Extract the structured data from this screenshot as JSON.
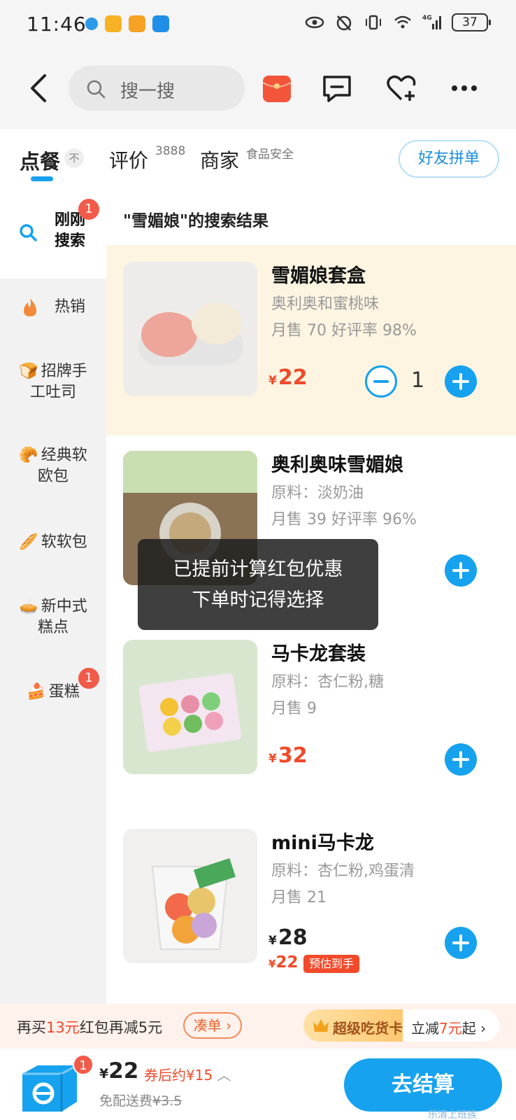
{
  "status_bar": {
    "time": "11:46",
    "battery": "37",
    "network": "4G"
  },
  "search": {
    "placeholder": "搜一搜"
  },
  "tabs": [
    {
      "label": "点餐",
      "sup": ""
    },
    {
      "label": "评价",
      "sup": "3888"
    },
    {
      "label": "商家",
      "sup": "食品安全"
    }
  ],
  "collapse_glyph": "不",
  "friend_order": "好友拼单",
  "sidebar": {
    "items": [
      {
        "label_line1": "刚刚",
        "label_line2": "搜索",
        "badge": "1"
      },
      {
        "label": "热销"
      },
      {
        "label_line1": "招牌手",
        "label_line2": "工吐司"
      },
      {
        "label_line1": "经典软",
        "label_line2": "欧包"
      },
      {
        "label": "软软包"
      },
      {
        "label_line1": "新中式",
        "label_line2": "糕点"
      },
      {
        "label": "蛋糕",
        "badge": "1"
      }
    ]
  },
  "results_title": "\"雪媚娘\"的搜索结果",
  "items": [
    {
      "name": "雪媚娘套盒",
      "desc": "奥利奥和蜜桃味",
      "sales": "月售 70  好评率 98%",
      "price": "22",
      "qty": "1"
    },
    {
      "name": "奥利奥味雪媚娘",
      "desc": "原料：淡奶油",
      "sales": "月售 39  好评率 96%"
    },
    {
      "name": "马卡龙套装",
      "desc": "原料：杏仁粉,糖",
      "sales": "月售 9",
      "price": "32"
    },
    {
      "name": "mini马卡龙",
      "desc": "原料：杏仁粉,鸡蛋清",
      "sales": "月售 21",
      "price": "28",
      "est_price": "22",
      "est_tag": "预估到手"
    }
  ],
  "toast": {
    "line1": "已提前计算红包优惠",
    "line2": "下单时记得选择"
  },
  "promo": {
    "text_before": "再买",
    "amount": "13元",
    "text_after": "红包再减5元",
    "button": "凑单",
    "vip_name": "超级吃货卡",
    "vip_text_before": "立减",
    "vip_amount": "7元",
    "vip_text_after": "起"
  },
  "checkout": {
    "cart_badge": "1",
    "total": "22",
    "coupon_price": "券后约¥15",
    "fee_label": "免配送费",
    "fee_original": "¥3.5",
    "button": "去结算"
  },
  "yen": "¥",
  "watermark": "乐清上班族",
  "colors": {
    "accent": "#16a2ee",
    "price_red": "#f04a2a",
    "highlight_bg": "#fdf5e2"
  }
}
